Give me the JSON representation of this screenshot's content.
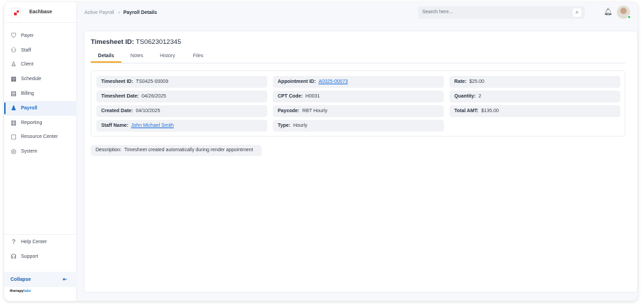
{
  "brand": {
    "name": "Eachbase",
    "footer_a": "therapy",
    "footer_b": "lake"
  },
  "sidebar": {
    "items": [
      {
        "label": "Payer",
        "icon": "shield-icon"
      },
      {
        "label": "Staff",
        "icon": "staff-icon"
      },
      {
        "label": "Client",
        "icon": "client-icon"
      },
      {
        "label": "Schedule",
        "icon": "calendar-icon"
      },
      {
        "label": "Billing",
        "icon": "billing-icon"
      },
      {
        "label": "Payroll",
        "icon": "payroll-icon"
      },
      {
        "label": "Reporting",
        "icon": "report-icon"
      },
      {
        "label": "Resource Center",
        "icon": "folder-icon"
      },
      {
        "label": "System",
        "icon": "system-icon"
      }
    ],
    "active": "Payroll",
    "bottom": [
      {
        "label": "Help Center"
      },
      {
        "label": "Support"
      }
    ],
    "collapse": "Collapse"
  },
  "breadcrumb": {
    "parent": "Active Payroll",
    "current": "Payroll Details"
  },
  "search": {
    "placeholder": "Search here..."
  },
  "page": {
    "title_label": "Timesheet ID:",
    "title_value": "TS0623012345",
    "tabs": [
      "Details",
      "Notes",
      "History",
      "Files"
    ],
    "active_tab": "Details"
  },
  "fields": [
    {
      "label": "Timesheet ID:",
      "value": "TS0425-00009"
    },
    {
      "label": "Timesheet Date:",
      "value": "04/26/2025"
    },
    {
      "label": "Created Date:",
      "value": "04/10/2025"
    },
    {
      "label": "Staff Name:",
      "value": "John Michael Smith",
      "link": true
    },
    {
      "label": "Appointment ID:",
      "value": "A0325-00073",
      "link": true
    },
    {
      "label": "CPT Code:",
      "value": "H0031"
    },
    {
      "label": "Paycode:",
      "value": "RBT Hourly"
    },
    {
      "label": "Type:",
      "value": "Hourly"
    },
    {
      "label": "Rate:",
      "value": "$25.00"
    },
    {
      "label": "Quantity:",
      "value": "2"
    },
    {
      "label": "Total AMT:",
      "value": "$135.00"
    }
  ],
  "description": {
    "label": "Description:",
    "value": "Timesheet created automatically during render appointment"
  },
  "colors": {
    "accent": "#1f6fc9",
    "tab_underline": "#f5a623",
    "brand": "#e8303a"
  }
}
